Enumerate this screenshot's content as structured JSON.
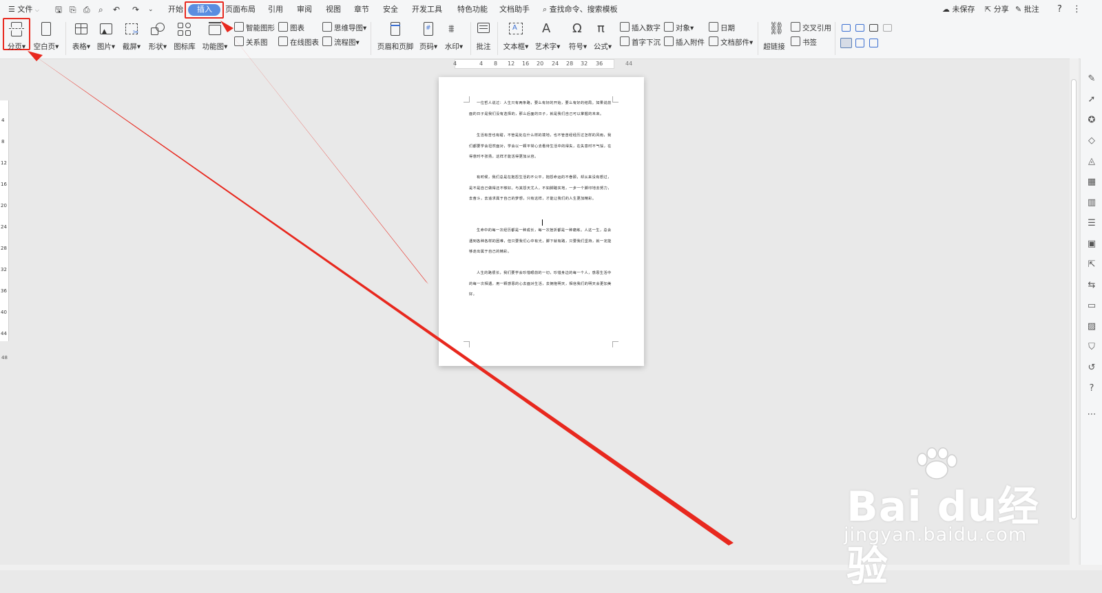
{
  "titlebar": {
    "menu_label": "文件",
    "tabs": [
      "开始",
      "插入",
      "页面布局",
      "引用",
      "审阅",
      "视图",
      "章节",
      "安全",
      "开发工具",
      "特色功能",
      "文档助手"
    ],
    "search_placeholder": "查找命令、搜索模板",
    "unsaved": "未保存",
    "share": "分享",
    "comment": "批注",
    "help": "?",
    "more": "⋮"
  },
  "ribbon": {
    "page_break": "分页",
    "blank_page": "空白页",
    "table": "表格",
    "image": "图片",
    "screenshot": "截屏",
    "shape": "形状",
    "icon_lib": "图标库",
    "function_chart": "功能图",
    "smart_shape": "智能图形",
    "relationship": "关系图",
    "chart": "图表",
    "online_chart": "在线图表",
    "mind_map": "思维导图",
    "flowchart": "流程图",
    "header_footer": "页眉和页脚",
    "page_number": "页码",
    "watermark": "水印",
    "comment": "批注",
    "text_box": "文本框",
    "art_text": "艺术字",
    "symbol": "符号",
    "formula": "公式",
    "insert_number": "插入数字",
    "drop_cap": "首字下沉",
    "object": "对象",
    "insert_attachment": "插入附件",
    "date": "日期",
    "doc_parts": "文档部件",
    "hyperlink": "超链接",
    "cross_ref": "交叉引用",
    "bookmark": "书签"
  },
  "ruler": {
    "h_ticks": [
      "4",
      "4",
      "8",
      "12",
      "16",
      "20",
      "24",
      "28",
      "32",
      "36",
      "44"
    ],
    "v_ticks": [
      "4",
      "8",
      "12",
      "16",
      "20",
      "24",
      "28",
      "32",
      "36",
      "40",
      "44",
      "48"
    ]
  },
  "document": {
    "paragraphs": [
      "一位哲人说过：人生只有两条路，要么有好的开始，要么有好的结局。如果说前面的日子是我们没有选择的，那么后面的日子，就是我们自己可以掌握的未来。",
      "生活有苦也有甜，不管是处在什么样的境地，也不管曾经经历过怎样的风雨，我们都要学会坦然面对，学会以一颗平常心去看待生活中的得失，在失意时不气馁，在得意时不张扬，这样才能活得更加从容。",
      "有时候，我们总是在抱怨生活的不公平，抱怨命运的不眷顾，却从来没有想过，是不是自己做得还不够好。与其怨天尤人，不如脚踏实地，一步一个脚印地去努力，去奋斗，去追求属于自己的梦想，只有这样，才能让我们的人生更加精彩。",
      "生命中的每一次经历都是一种成长，每一次挫折都是一种磨练。人这一生，总会遇到各种各样的困难，但只要我们心中有光，脚下就有路，只要我们坚持，就一定能够走出属于自己的精彩。",
      "人生的路很长，我们要学会珍惜眼前的一切，珍惜身边的每一个人，感恩生活中的每一次相遇，用一颗感恩的心去面对生活，去拥抱明天，相信我们的明天会更加美好。"
    ]
  },
  "watermark": {
    "logo": "Bai du经验",
    "url": "jingyan.baidu.com"
  },
  "colors": {
    "accent": "#5a8de0",
    "highlight_red": "#e8281e"
  }
}
